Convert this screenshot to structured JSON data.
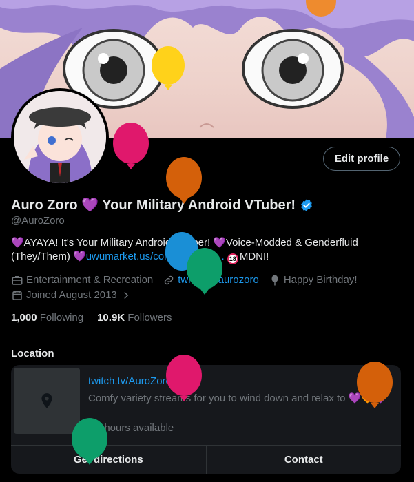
{
  "profile": {
    "display_name": "Auro Zoro 💜 Your Military Android VTuber!",
    "handle": "@AuroZoro",
    "edit_label": "Edit profile"
  },
  "bio": {
    "part1": "💜AYAYA! It's Your Military Android VTuber! 💜Voice-Modded & Genderfluid (They/Them) 💜",
    "link": "uwumarket.us/collections/au...",
    "badge": "18",
    "part2": "MDNI!"
  },
  "meta": {
    "category": "Entertainment & Recreation",
    "website": "twitch.tv/aurozoro",
    "birthday": "Happy Birthday!",
    "joined": "Joined August 2013"
  },
  "stats": {
    "following_count": "1,000",
    "following_label": "Following",
    "followers_count": "10.9K",
    "followers_label": "Followers"
  },
  "location": {
    "title": "Location",
    "link": "twitch.tv/AuroZoro",
    "description": "Comfy variety streams for you to wind down and relax to 💜🧡💜",
    "hours": "No hours available",
    "directions_label": "Get directions",
    "contact_label": "Contact"
  },
  "colors": {
    "accent": "#1d9bf0",
    "muted": "#71767b",
    "text": "#e7e9ea"
  }
}
